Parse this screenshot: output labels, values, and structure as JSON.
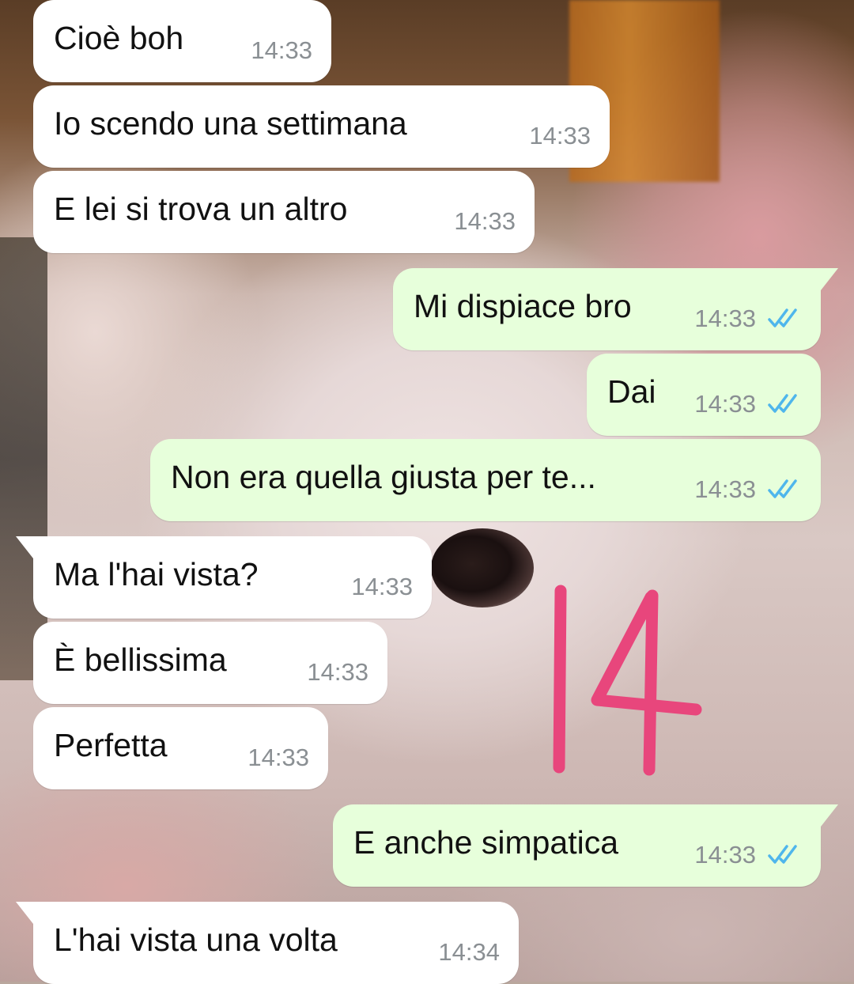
{
  "messages": [
    {
      "dir": "in",
      "text": "Cioè boh",
      "time": "14:33"
    },
    {
      "dir": "in",
      "text": "Io scendo una settimana",
      "time": "14:33"
    },
    {
      "dir": "in",
      "text": "E lei si trova un altro",
      "time": "14:33"
    },
    {
      "dir": "out",
      "text": "Mi dispiace bro",
      "time": "14:33",
      "status": "read"
    },
    {
      "dir": "out",
      "text": "Dai",
      "time": "14:33",
      "status": "read"
    },
    {
      "dir": "out",
      "text": "Non era quella giusta per te...",
      "time": "14:33",
      "status": "read"
    },
    {
      "dir": "in",
      "text": "Ma l'hai vista?",
      "time": "14:33"
    },
    {
      "dir": "in",
      "text": "È bellissima",
      "time": "14:33"
    },
    {
      "dir": "in",
      "text": "Perfetta",
      "time": "14:33"
    },
    {
      "dir": "out",
      "text": "E anche simpatica",
      "time": "14:33",
      "status": "read"
    },
    {
      "dir": "in",
      "text": "L'hai vista una volta",
      "time": "14:34"
    }
  ],
  "overlay_annotation": "14",
  "colors": {
    "incoming_bubble": "#ffffff",
    "outgoing_bubble": "#e7ffdb",
    "read_ticks": "#4fb6ec",
    "annotation": "#e8467c",
    "timestamp": "#8a8f93"
  },
  "icons": {
    "read_receipt": "double-check-icon"
  }
}
